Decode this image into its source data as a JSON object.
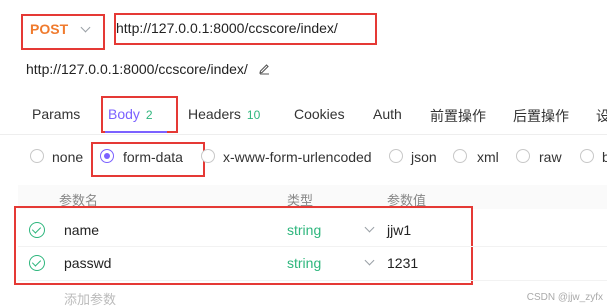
{
  "request": {
    "method": "POST",
    "url": "http://127.0.0.1:8000/ccscore/index/",
    "url_display": "http://127.0.0.1:8000/ccscore/index/"
  },
  "tabs": [
    {
      "label": "Params",
      "count": ""
    },
    {
      "label": "Body",
      "count": "2"
    },
    {
      "label": "Headers",
      "count": "10"
    },
    {
      "label": "Cookies",
      "count": ""
    },
    {
      "label": "Auth",
      "count": ""
    },
    {
      "label": "前置操作",
      "count": ""
    },
    {
      "label": "后置操作",
      "count": ""
    },
    {
      "label": "设",
      "count": ""
    }
  ],
  "body_types": [
    "none",
    "form-data",
    "x-www-form-urlencoded",
    "json",
    "xml",
    "raw",
    "b"
  ],
  "selected_body_type": "form-data",
  "table": {
    "headers": [
      "参数名",
      "类型",
      "参数值"
    ],
    "rows": [
      {
        "name": "name",
        "type": "string",
        "value": "jjw1"
      },
      {
        "name": "passwd",
        "type": "string",
        "value": "1231"
      }
    ],
    "add_placeholder": "添加参数"
  },
  "watermark": "CSDN @jjw_zyfx",
  "colors": {
    "accent": "#7b61ff",
    "method": "#f07b2e",
    "green": "#2eb67d",
    "highlight": "#e53935"
  }
}
